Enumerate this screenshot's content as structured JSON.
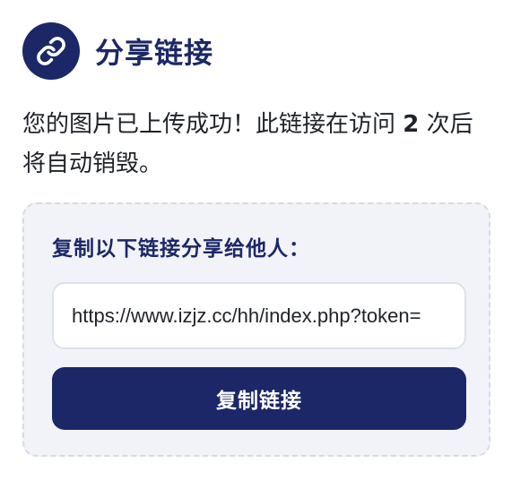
{
  "header": {
    "icon": "link-icon",
    "title": "分享链接"
  },
  "description": {
    "before": "您的图片已上传成功！此链接在访问 ",
    "visits": "2",
    "after": " 次后将自动销毁。"
  },
  "share": {
    "label": "复制以下链接分享给他人：",
    "url": "https://www.izjz.cc/hh/index.php?token=",
    "copy_button": "复制链接"
  },
  "colors": {
    "primary": "#1c2767",
    "box_background": "#f1f3f8",
    "box_border": "#d7dbe5",
    "text": "#1f2329"
  }
}
